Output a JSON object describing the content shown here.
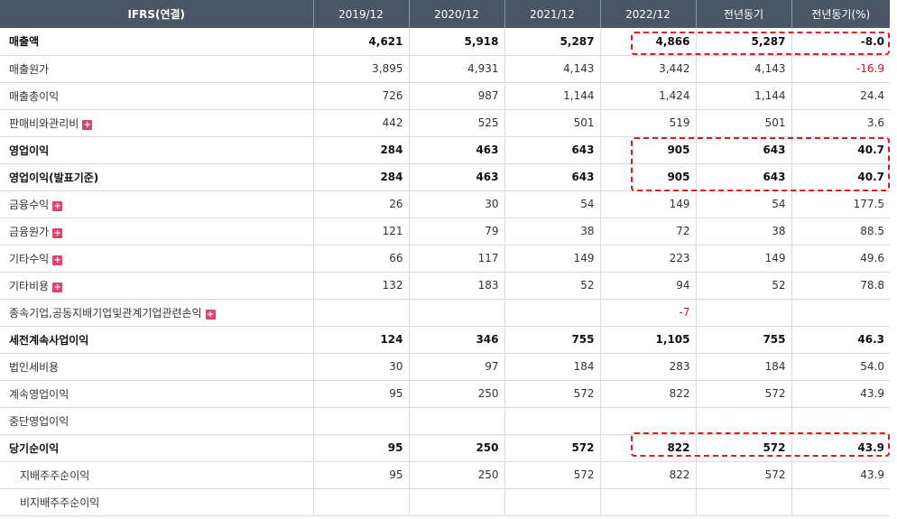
{
  "header": {
    "label": "IFRS(연결)",
    "columns": [
      "2019/12",
      "2020/12",
      "2021/12",
      "2022/12",
      "전년동기",
      "전년동기(%)"
    ]
  },
  "rows": [
    {
      "label": "매출액",
      "values": [
        "4,621",
        "5,918",
        "5,287",
        "4,866",
        "5,287",
        "-8.0"
      ],
      "bold": true,
      "plus": false
    },
    {
      "label": "매출원가",
      "values": [
        "3,895",
        "4,931",
        "4,143",
        "3,442",
        "4,143",
        "-16.9"
      ],
      "bold": false,
      "plus": false
    },
    {
      "label": "매출총이익",
      "values": [
        "726",
        "987",
        "1,144",
        "1,424",
        "1,144",
        "24.4"
      ],
      "bold": false,
      "plus": false
    },
    {
      "label": "판매비와관리비",
      "values": [
        "442",
        "525",
        "501",
        "519",
        "501",
        "3.6"
      ],
      "bold": false,
      "plus": true
    },
    {
      "label": "영업이익",
      "values": [
        "284",
        "463",
        "643",
        "905",
        "643",
        "40.7"
      ],
      "bold": true,
      "plus": false
    },
    {
      "label": "영업이익(발표기준)",
      "values": [
        "284",
        "463",
        "643",
        "905",
        "643",
        "40.7"
      ],
      "bold": true,
      "plus": false
    },
    {
      "label": "금융수익",
      "values": [
        "26",
        "30",
        "54",
        "149",
        "54",
        "177.5"
      ],
      "bold": false,
      "plus": true
    },
    {
      "label": "금융원가",
      "values": [
        "121",
        "79",
        "38",
        "72",
        "38",
        "88.5"
      ],
      "bold": false,
      "plus": true
    },
    {
      "label": "기타수익",
      "values": [
        "66",
        "117",
        "149",
        "223",
        "149",
        "49.6"
      ],
      "bold": false,
      "plus": true
    },
    {
      "label": "기타비용",
      "values": [
        "132",
        "183",
        "52",
        "94",
        "52",
        "78.8"
      ],
      "bold": false,
      "plus": true
    },
    {
      "label": "종속기업,공동지배기업및관계기업관련손익",
      "values": [
        "",
        "",
        "",
        "-7",
        "",
        ""
      ],
      "bold": false,
      "plus": true
    },
    {
      "label": "세전계속사업이익",
      "values": [
        "124",
        "346",
        "755",
        "1,105",
        "755",
        "46.3"
      ],
      "bold": true,
      "plus": false
    },
    {
      "label": "법인세비용",
      "values": [
        "30",
        "97",
        "184",
        "283",
        "184",
        "54.0"
      ],
      "bold": false,
      "plus": false
    },
    {
      "label": "계속영업이익",
      "values": [
        "95",
        "250",
        "572",
        "822",
        "572",
        "43.9"
      ],
      "bold": false,
      "plus": false
    },
    {
      "label": "중단영업이익",
      "values": [
        "",
        "",
        "",
        "",
        "",
        ""
      ],
      "bold": false,
      "plus": false
    },
    {
      "label": "당기순이익",
      "values": [
        "95",
        "250",
        "572",
        "822",
        "572",
        "43.9"
      ],
      "bold": true,
      "plus": false
    },
    {
      "label": "지배주주순이익",
      "values": [
        "95",
        "250",
        "572",
        "822",
        "572",
        "43.9"
      ],
      "bold": false,
      "plus": false,
      "indent": true
    },
    {
      "label": "비지배주주순이익",
      "values": [
        "",
        "",
        "",
        "",
        "",
        ""
      ],
      "bold": false,
      "plus": false,
      "indent": true
    }
  ],
  "colors": {
    "header_bg": "#4a5565",
    "negative": "#d01818",
    "highlight": "#e01818",
    "plus_icon": "#d9456e"
  }
}
